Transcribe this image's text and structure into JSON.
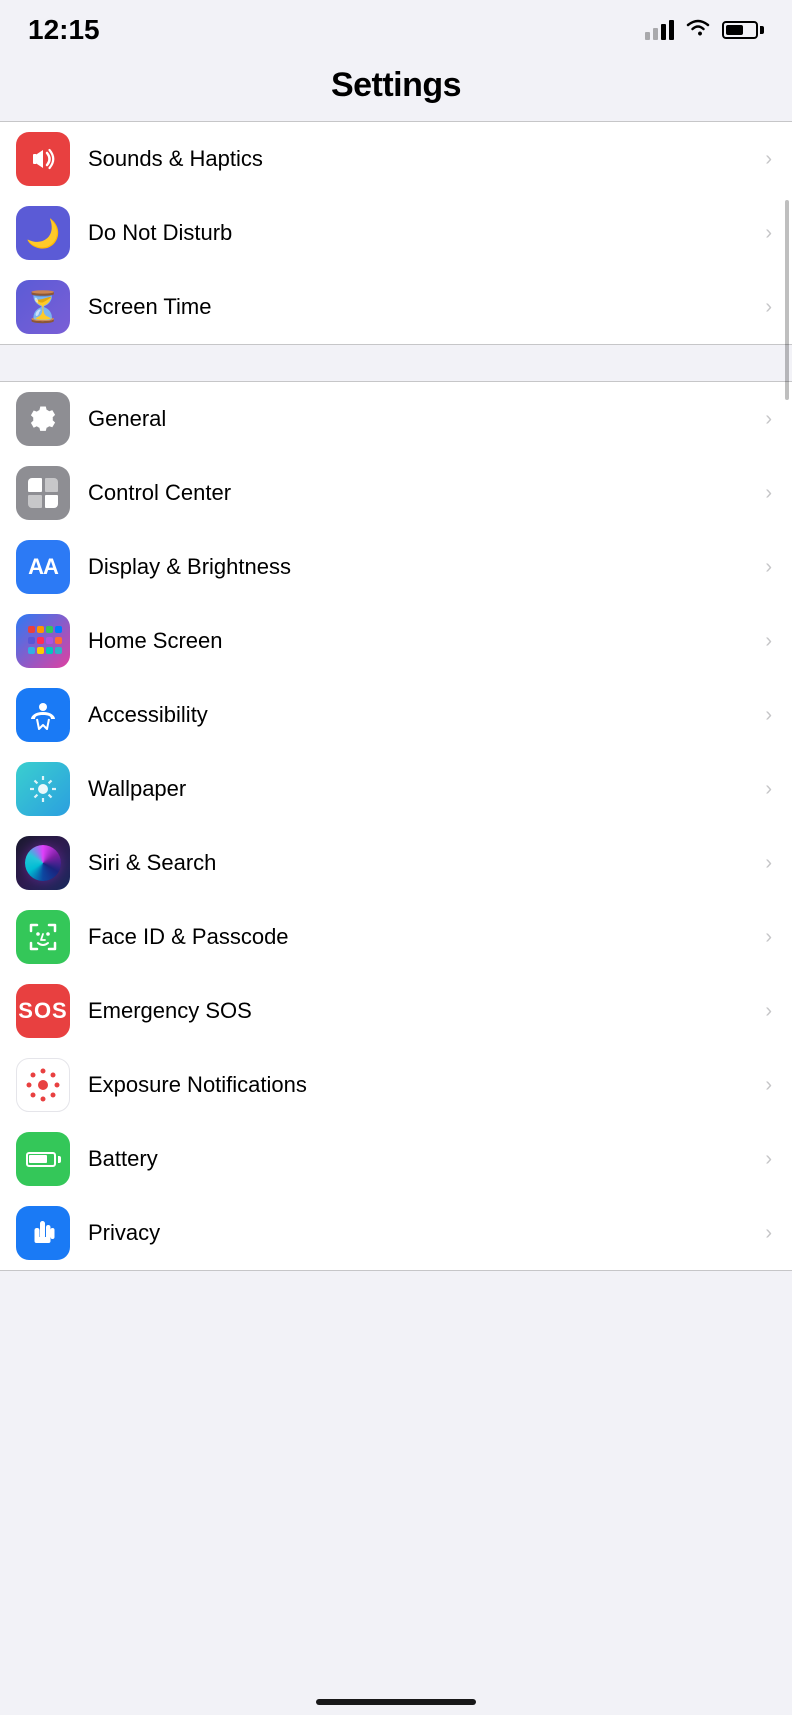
{
  "statusBar": {
    "time": "12:15",
    "signal": [
      1,
      2,
      3,
      4
    ],
    "signalActive": 2,
    "batteryPercent": 60
  },
  "header": {
    "title": "Settings"
  },
  "groups": [
    {
      "id": "group1",
      "items": [
        {
          "id": "sounds-haptics",
          "label": "Sounds & Haptics",
          "iconType": "sounds"
        },
        {
          "id": "do-not-disturb",
          "label": "Do Not Disturb",
          "iconType": "dnd"
        },
        {
          "id": "screen-time",
          "label": "Screen Time",
          "iconType": "screentime"
        }
      ]
    },
    {
      "id": "group2",
      "items": [
        {
          "id": "general",
          "label": "General",
          "iconType": "general"
        },
        {
          "id": "control-center",
          "label": "Control Center",
          "iconType": "control"
        },
        {
          "id": "display-brightness",
          "label": "Display & Brightness",
          "iconType": "display"
        },
        {
          "id": "home-screen",
          "label": "Home Screen",
          "iconType": "homescreen"
        },
        {
          "id": "accessibility",
          "label": "Accessibility",
          "iconType": "access"
        },
        {
          "id": "wallpaper",
          "label": "Wallpaper",
          "iconType": "wallpaper"
        },
        {
          "id": "siri-search",
          "label": "Siri & Search",
          "iconType": "siri"
        },
        {
          "id": "face-id",
          "label": "Face ID & Passcode",
          "iconType": "faceid"
        },
        {
          "id": "emergency-sos",
          "label": "Emergency SOS",
          "iconType": "sos"
        },
        {
          "id": "exposure",
          "label": "Exposure Notifications",
          "iconType": "exposure"
        },
        {
          "id": "battery",
          "label": "Battery",
          "iconType": "battery"
        },
        {
          "id": "privacy",
          "label": "Privacy",
          "iconType": "privacy"
        }
      ]
    }
  ],
  "chevron": "›"
}
